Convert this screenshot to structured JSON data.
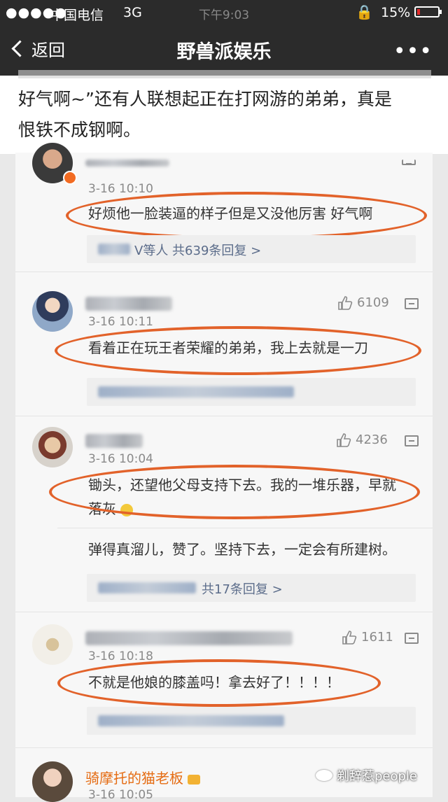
{
  "status": {
    "signal": "●●●●●",
    "carrier": "中国电信",
    "network": "3G",
    "time": "下午9:03",
    "battery_text": "15%",
    "battery_level": 0.15,
    "lock_icon": "rotation-lock-icon"
  },
  "nav": {
    "back_label": "返回",
    "title": "野兽派娱乐",
    "more_label": "•••"
  },
  "article": {
    "line1": "好气啊~”还有人联想起正在打网游的弟弟，真是",
    "line2": "恨铁不成钢啊。"
  },
  "comments": [
    {
      "time": "3-16 10:10",
      "text": "好烦他一脸装逼的样子但是又没他厉害 好气啊",
      "reply_suffix": "V等人  共639条回复 >"
    },
    {
      "likes": "6109",
      "time": "3-16 10:11",
      "text": "看着正在玩王者荣耀的弟弟，我上去就是一刀"
    },
    {
      "likes": "4236",
      "time": "3-16 10:04",
      "text_line1": "锄头，还望他父母支持下去。我的一堆乐器，早就",
      "text_line2": "落灰",
      "reply_text": "弹得真溜儿，赞了。坚持下去，一定会有所建树。",
      "reply_suffix": "共17条回复 >"
    },
    {
      "likes": "1611",
      "time": "3-16 10:18",
      "text": "不就是他娘的膝盖吗！拿去好了！！！！"
    },
    {
      "name": "骑摩托的猫老板",
      "time": "3-16 10:05"
    }
  ],
  "watermark": "剃辞惹people",
  "colors": {
    "bar": "#2b2b2b",
    "highlight_oval": "#e2622a",
    "username": "#e56c13",
    "reply_link": "#5b6c8a"
  }
}
